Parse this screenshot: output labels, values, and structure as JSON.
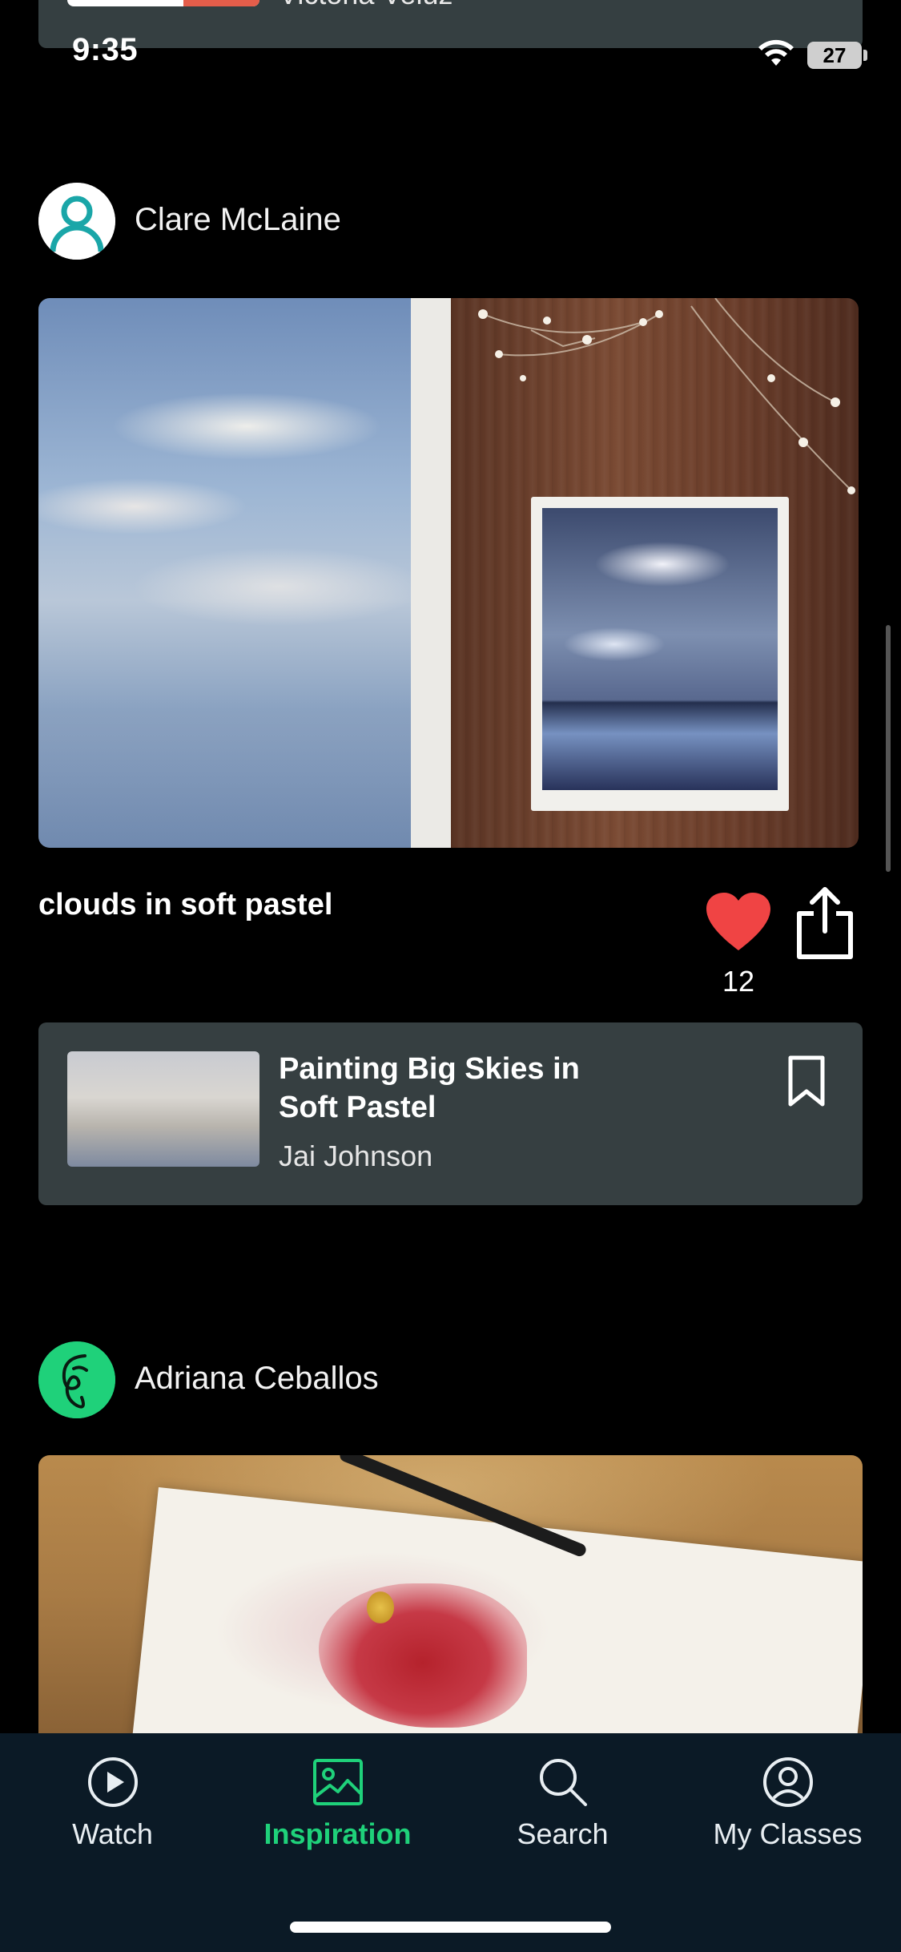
{
  "status_bar": {
    "time": "9:35",
    "battery": "27"
  },
  "top_card": {
    "author": "Victoria Veluz"
  },
  "posts": [
    {
      "author": "Clare McLaine",
      "caption": "clouds in soft pastel",
      "likes": "12",
      "class": {
        "title": "Painting Big Skies in Soft Pastel",
        "instructor": "Jai Johnson"
      }
    },
    {
      "author": "Adriana Ceballos"
    }
  ],
  "tabs": [
    {
      "label": "Watch",
      "icon": "play-circle-icon",
      "active": false
    },
    {
      "label": "Inspiration",
      "icon": "image-icon",
      "active": true
    },
    {
      "label": "Search",
      "icon": "search-icon",
      "active": false
    },
    {
      "label": "My Classes",
      "icon": "user-circle-icon",
      "active": false
    }
  ],
  "colors": {
    "accent": "#1fd17a",
    "heart": "#f04444",
    "card": "#363f41",
    "tabbar": "#0b1a26"
  }
}
